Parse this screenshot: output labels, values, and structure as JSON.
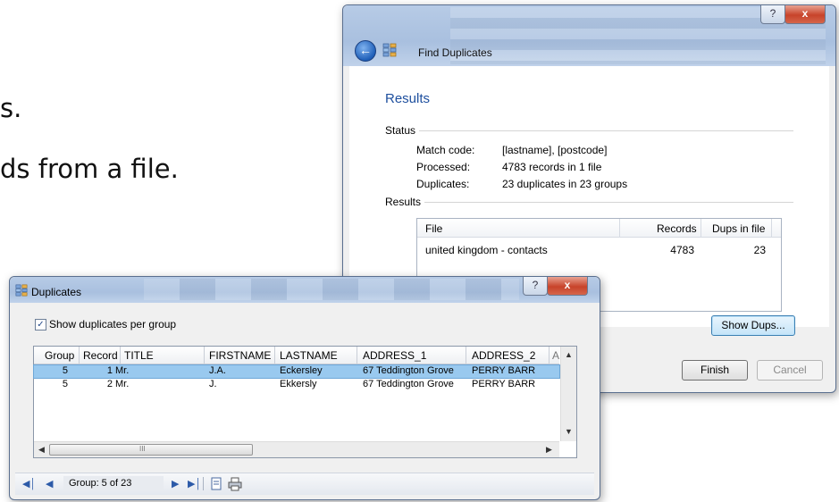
{
  "slide": {
    "line1": "s.",
    "line2": "ds from a file."
  },
  "find_window": {
    "title": "Find Duplicates",
    "help_btn": "?",
    "close_btn": "x",
    "back_icon": "arrow-left-icon",
    "heading": "Results",
    "status_label": "Status",
    "results_label": "Results",
    "status": [
      {
        "key": "Match code:",
        "value": "[lastname], [postcode]"
      },
      {
        "key": "Processed:",
        "value": "4783 records in 1 file"
      },
      {
        "key": "Duplicates:",
        "value": "23 duplicates in 23 groups"
      }
    ],
    "table": {
      "headers": {
        "file": "File",
        "records": "Records",
        "dups": "Dups in file"
      },
      "rows": [
        {
          "file": "united kingdom - contacts",
          "records": "4783",
          "dups": "23"
        }
      ]
    },
    "show_dups_btn": "Show Dups...",
    "finish_btn": "Finish",
    "cancel_btn": "Cancel"
  },
  "dups_window": {
    "title": "Duplicates",
    "help_btn": "?",
    "close_btn": "x",
    "checkbox_label": "Show duplicates per group",
    "checkbox_checked": true,
    "columns": [
      "Group",
      "Record",
      "TITLE",
      "FIRSTNAME",
      "LASTNAME",
      "ADDRESS_1",
      "ADDRESS_2",
      "A"
    ],
    "rows": [
      {
        "group": "5",
        "record": "1",
        "title": "Mr.",
        "firstname": "J.A.",
        "lastname": "Eckersley",
        "address1": "67 Teddington Grove",
        "address2": "PERRY BARR",
        "selected": true
      },
      {
        "group": "5",
        "record": "2",
        "title": "Mr.",
        "firstname": "J.",
        "lastname": "Ekkersly",
        "address1": "67 Teddington Grove",
        "address2": "PERRY BARR",
        "selected": false
      }
    ],
    "scroll_thumb_label": "III",
    "nav": {
      "group_text": "Group: 5 of 23"
    }
  }
}
